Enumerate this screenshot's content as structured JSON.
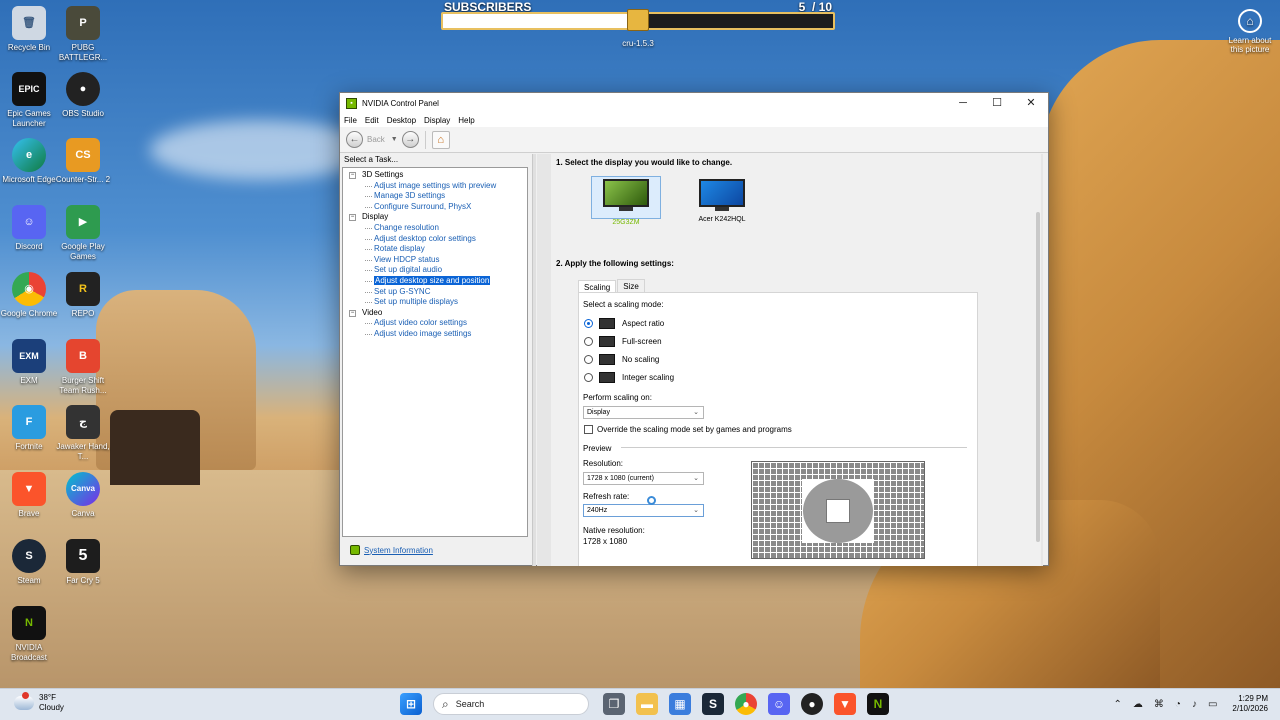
{
  "desktop": {
    "icons": [
      {
        "label": "Recycle Bin",
        "glyph": "🗑"
      },
      {
        "label": "PUBG BATTLEGR...",
        "glyph": "P"
      },
      {
        "label": "Epic Games Launcher",
        "glyph": "EPIC"
      },
      {
        "label": "OBS Studio",
        "glyph": "●"
      },
      {
        "label": "Microsoft Edge",
        "glyph": "e"
      },
      {
        "label": "Counter-Str... 2",
        "glyph": "CS"
      },
      {
        "label": "Discord",
        "glyph": "☺"
      },
      {
        "label": "Google Play Games",
        "glyph": "▶"
      },
      {
        "label": "Google Chrome",
        "glyph": "◉"
      },
      {
        "label": "REPO",
        "glyph": "R"
      },
      {
        "label": "EXM",
        "glyph": "EXM"
      },
      {
        "label": "Burger Shift Team Rush...",
        "glyph": "B"
      },
      {
        "label": "Fortnite",
        "glyph": "F"
      },
      {
        "label": "Jawaker Hand, T...",
        "glyph": "ج"
      },
      {
        "label": "Brave",
        "glyph": "▼"
      },
      {
        "label": "Canva",
        "glyph": "Canva"
      },
      {
        "label": "Steam",
        "glyph": "S"
      },
      {
        "label": "Far Cry 5",
        "glyph": "5"
      },
      {
        "label": "NVIDIA Broadcast",
        "glyph": "N"
      }
    ],
    "learn": "Learn about this picture"
  },
  "subscribers": {
    "label": "SUBSCRIBERS",
    "current": "5",
    "sep": "/",
    "goal": "10",
    "progress": 0.5,
    "version": "cru-1.5.3"
  },
  "window": {
    "title": "NVIDIA Control Panel",
    "menu": [
      "File",
      "Edit",
      "Desktop",
      "Display",
      "Help"
    ],
    "toolbar": {
      "back": "Back"
    },
    "task_header": "Select a Task...",
    "tree": [
      {
        "category": "3D Settings",
        "items": [
          "Adjust image settings with preview",
          "Manage 3D settings",
          "Configure Surround, PhysX"
        ]
      },
      {
        "category": "Display",
        "items": [
          "Change resolution",
          "Adjust desktop color settings",
          "Rotate display",
          "View HDCP status",
          "Set up digital audio",
          "Adjust desktop size and position",
          "Set up G-SYNC",
          "Set up multiple displays"
        ]
      },
      {
        "category": "Video",
        "items": [
          "Adjust video color settings",
          "Adjust video image settings"
        ]
      }
    ],
    "selected_item": "Adjust desktop size and position",
    "system_info": "System Information",
    "step1": "1. Select the display you would like to change.",
    "displays": [
      {
        "name": "25G3ZM",
        "selected": true
      },
      {
        "name": "Acer K242HQL",
        "selected": false
      }
    ],
    "step2": "2. Apply the following settings:",
    "tabs": [
      "Scaling",
      "Size"
    ],
    "scaling_prompt": "Select a scaling mode:",
    "modes": [
      {
        "label": "Aspect ratio",
        "checked": true
      },
      {
        "label": "Full-screen",
        "checked": false
      },
      {
        "label": "No scaling",
        "checked": false
      },
      {
        "label": "Integer scaling",
        "checked": false
      }
    ],
    "perform_label": "Perform scaling on:",
    "perform_value": "Display",
    "override_label": "Override the scaling mode set by games and programs",
    "preview_label": "Preview",
    "resolution_label": "Resolution:",
    "resolution_value": "1728 x 1080 (current)",
    "refresh_label": "Refresh rate:",
    "refresh_value": "240Hz",
    "native_label": "Native resolution:",
    "native_value": "1728 x 1080"
  },
  "taskbar": {
    "weather_temp": "38°F",
    "weather_cond": "Cloudy",
    "search": "Search",
    "time": "1:29 PM",
    "date": "2/10/2026"
  }
}
